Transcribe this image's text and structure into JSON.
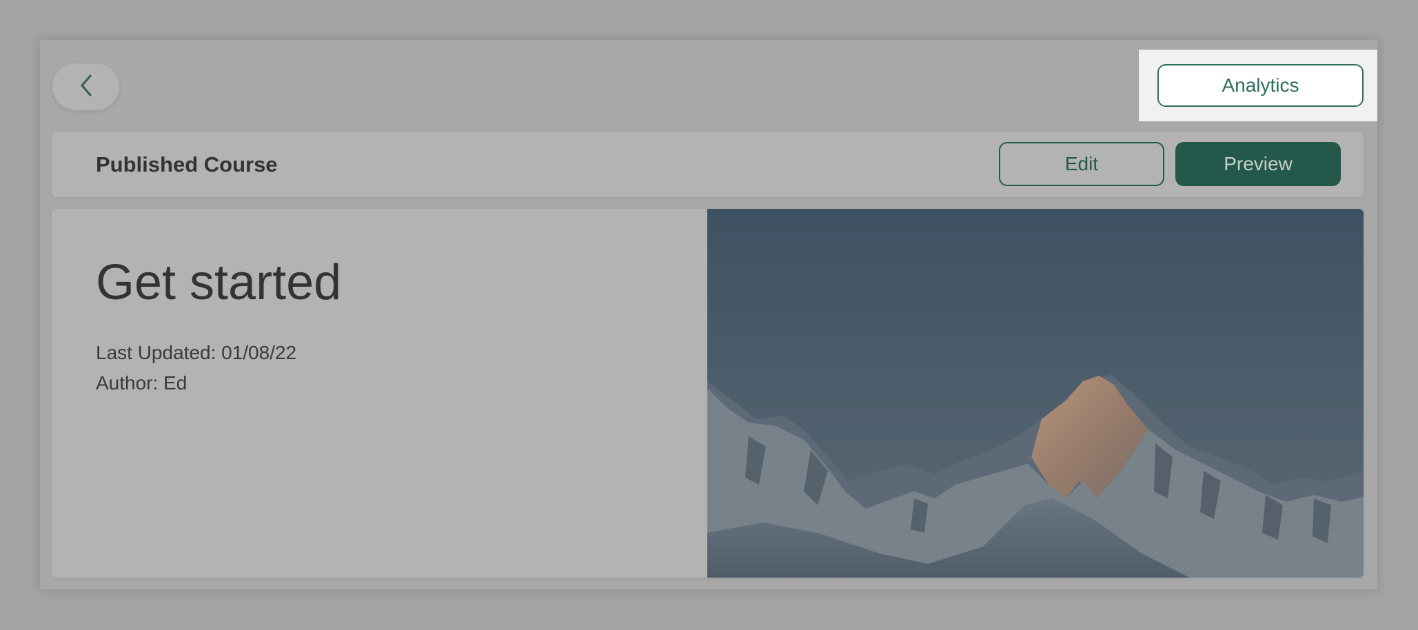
{
  "header": {
    "back_icon": "chevron-left-icon",
    "analytics_label": "Analytics"
  },
  "course_bar": {
    "title": "Published Course",
    "edit_label": "Edit",
    "preview_label": "Preview"
  },
  "content": {
    "headline": "Get started",
    "last_updated": "Last Updated: 01/08/22",
    "author": "Author: Ed",
    "image": "mountain-peak-image"
  },
  "colors": {
    "accent": "#24584b",
    "accent_outline": "#2f6e5c",
    "overlay_background": "#a3a3a3",
    "highlight_background": "#f1f1f1"
  }
}
